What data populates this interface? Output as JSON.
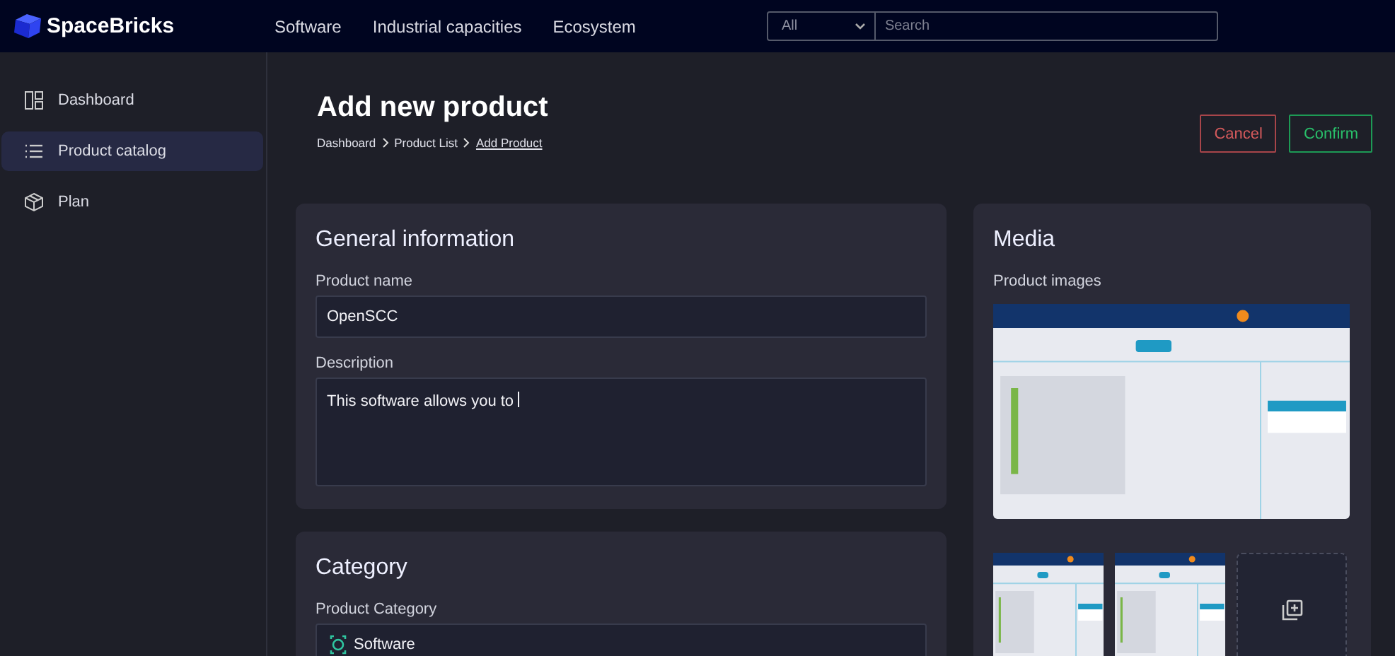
{
  "header": {
    "logo": "SpaceBricks",
    "nav": [
      {
        "label": "Software"
      },
      {
        "label": "Industrial capacities"
      },
      {
        "label": "Ecosystem"
      }
    ],
    "search": {
      "scope": "All",
      "placeholder": "Search"
    }
  },
  "sidebar": {
    "items": [
      {
        "label": "Dashboard",
        "kind": "dashboard",
        "selected": false
      },
      {
        "label": "Product catalog",
        "kind": "list",
        "selected": true
      },
      {
        "label": "Plan",
        "kind": "box",
        "selected": false
      }
    ]
  },
  "page": {
    "title": "Add new product",
    "breadcrumb": [
      "Dashboard",
      "Product List",
      "Add Product"
    ],
    "buttons": [
      {
        "label": "Cancel",
        "kind": "cancel"
      },
      {
        "label": "Confirm",
        "kind": "confirm"
      }
    ]
  },
  "general": {
    "title": "General information",
    "fields": [
      {
        "label": "Product name",
        "value": "OpenSCC",
        "kind": "input",
        "focused": false
      },
      {
        "label": "Description",
        "value": "This software allows you to ",
        "kind": "textarea",
        "focused": true
      }
    ]
  },
  "category": {
    "title": "Category",
    "label": "Product Category",
    "value": "Software"
  },
  "media": {
    "title": "Media",
    "label": "Product images"
  }
}
